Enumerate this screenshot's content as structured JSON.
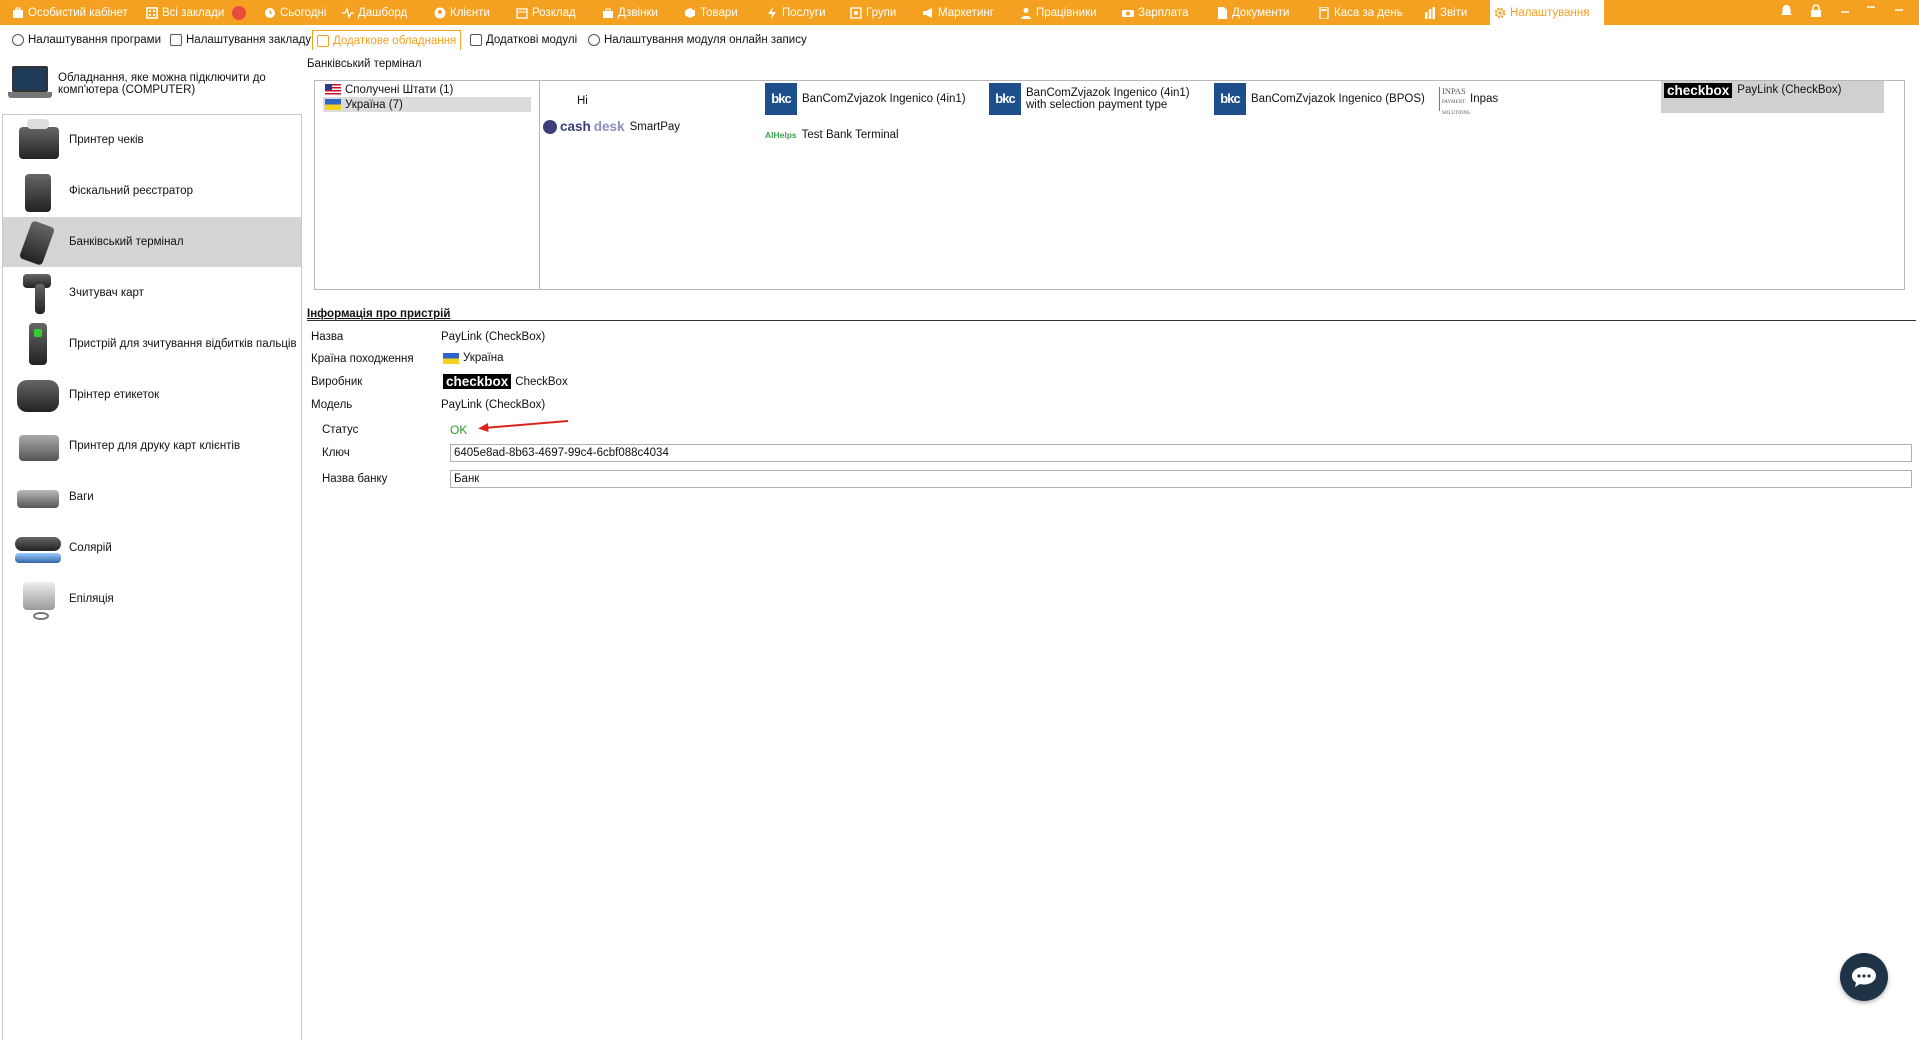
{
  "topnav": {
    "items": [
      {
        "label": "Особистий кабінет",
        "icon": "briefcase-icon"
      },
      {
        "label": "Всі заклади",
        "icon": "building-icon"
      },
      {
        "label": "Сьогодні",
        "icon": "clock-icon"
      },
      {
        "label": "Дашборд",
        "icon": "pulse-icon"
      },
      {
        "label": "Клієнти",
        "icon": "user-circle-icon"
      },
      {
        "label": "Розклад",
        "icon": "calendar-icon"
      },
      {
        "label": "Дзвінки",
        "icon": "bag-icon"
      },
      {
        "label": "Товари",
        "icon": "box-icon"
      },
      {
        "label": "Послуги",
        "icon": "bolt-icon"
      },
      {
        "label": "Групи",
        "icon": "group-icon"
      },
      {
        "label": "Маркетинг",
        "icon": "megaphone-icon"
      },
      {
        "label": "Працівники",
        "icon": "person-icon"
      },
      {
        "label": "Зарплата",
        "icon": "money-icon"
      },
      {
        "label": "Документи",
        "icon": "document-icon"
      },
      {
        "label": "Каса за день",
        "icon": "calculator-icon"
      },
      {
        "label": "Звіти",
        "icon": "bar-chart-icon"
      },
      {
        "label": "Налаштування",
        "icon": "gear-icon"
      }
    ],
    "active_color": "#f4a020"
  },
  "subnav": {
    "items": [
      {
        "label": "Налаштування програми"
      },
      {
        "label": "Налаштування закладу"
      },
      {
        "label": "Додаткове обладнання"
      },
      {
        "label": "Додаткові модулі"
      },
      {
        "label": "Налаштування модуля онлайн запису"
      }
    ]
  },
  "sidebar": {
    "header": "Обладнання, яке можна підключити до комп'ютера (COMPUTER)",
    "items": [
      {
        "label": "Принтер чеків"
      },
      {
        "label": "Фіскальний реєстратор"
      },
      {
        "label": "Банківський термінал"
      },
      {
        "label": "Зчитувач карт"
      },
      {
        "label": "Пристрій для зчитування відбитків пальців"
      },
      {
        "label": "Прінтер етикеток"
      },
      {
        "label": "Принтер для друку карт клієнтів"
      },
      {
        "label": "Ваги"
      },
      {
        "label": "Солярій"
      },
      {
        "label": "Епіляція"
      }
    ]
  },
  "terminal": {
    "section_title": "Банківський термінал",
    "countries": [
      {
        "label": "Сполучені Штати (1)"
      },
      {
        "label": "Україна (7)"
      }
    ],
    "devices": {
      "hi": "Hi",
      "bancom1": "BanComZvjazok Ingenico (4in1)",
      "bancom2": "BanComZvjazok Ingenico (4in1) with selection payment type",
      "bancom3": "BanComZvjazok Ingenico (BPOS)",
      "inpas": "Inpas",
      "inpas_logo_top": "INPAS",
      "inpas_logo_bottom": "PAYMENT SOLUTIONS",
      "paylink": "PayLink (CheckBox)",
      "checkbox_logo": "checkbox",
      "smartpay": "SmartPay",
      "cashdesk_a": "cash",
      "cashdesk_b": "desk",
      "testbank": "Test Bank Terminal",
      "alhelps_a": "Al",
      "alhelps_b": "Helps",
      "bkc_logo": "bkc"
    }
  },
  "info": {
    "title": "Інформація про пристрій",
    "name_label": "Назва",
    "name_value": "PayLink (CheckBox)",
    "country_label": "Країна походження",
    "country_value": "Україна",
    "maker_label": "Виробник",
    "maker_logo": "checkbox",
    "maker_value": "CheckBox",
    "model_label": "Модель",
    "model_value": "PayLink (CheckBox)",
    "status_label": "Статус",
    "status_value": "OK",
    "key_label": "Ключ",
    "key_value": "6405e8ad-8b63-4697-99c4-6cbf088c4034",
    "bank_label": "Назва банку",
    "bank_value": "Банк",
    "status_color": "#2b9a2b",
    "arrow_color": "#d9261c"
  }
}
